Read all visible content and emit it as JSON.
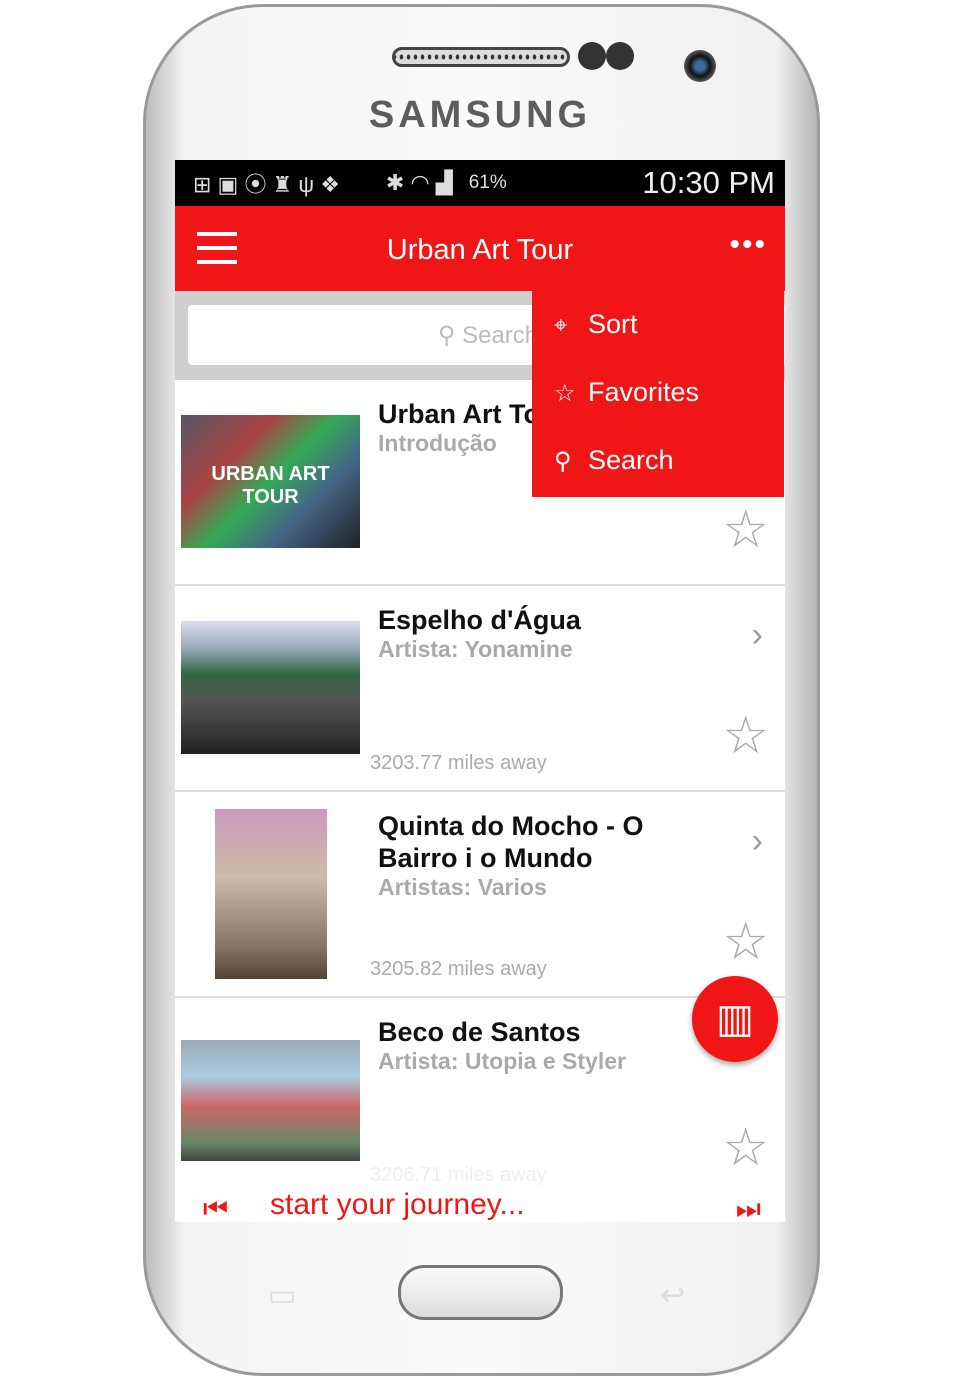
{
  "device": {
    "brand": "SAMSUNG"
  },
  "status_bar": {
    "battery": "61%",
    "time": "10:30 PM"
  },
  "app_bar": {
    "title": "Urban Art Tour"
  },
  "search": {
    "placeholder": "Search"
  },
  "overflow_menu": {
    "items": [
      {
        "label": "Sort",
        "icon": "location-pin-icon"
      },
      {
        "label": "Favorites",
        "icon": "star-icon"
      },
      {
        "label": "Search",
        "icon": "search-icon"
      }
    ]
  },
  "list": [
    {
      "title": "Urban Art Tour",
      "subtitle": "Introdução",
      "distance": ""
    },
    {
      "title": "Espelho d'Água",
      "subtitle": "Artista: Yonamine",
      "distance": "3203.77 miles away"
    },
    {
      "title": "Quinta do Mocho - O Bairro i o Mundo",
      "subtitle": "Artistas: Varios",
      "distance": "3205.82 miles away"
    },
    {
      "title": "Beco de Santos",
      "subtitle": "Artista: Utopia e Styler",
      "distance": "3206.71 miles away"
    }
  ],
  "thumb_logo": {
    "text": "URBAN ART TOUR"
  },
  "footer": {
    "text": "start your journey..."
  },
  "colors": {
    "accent": "#f01616"
  }
}
